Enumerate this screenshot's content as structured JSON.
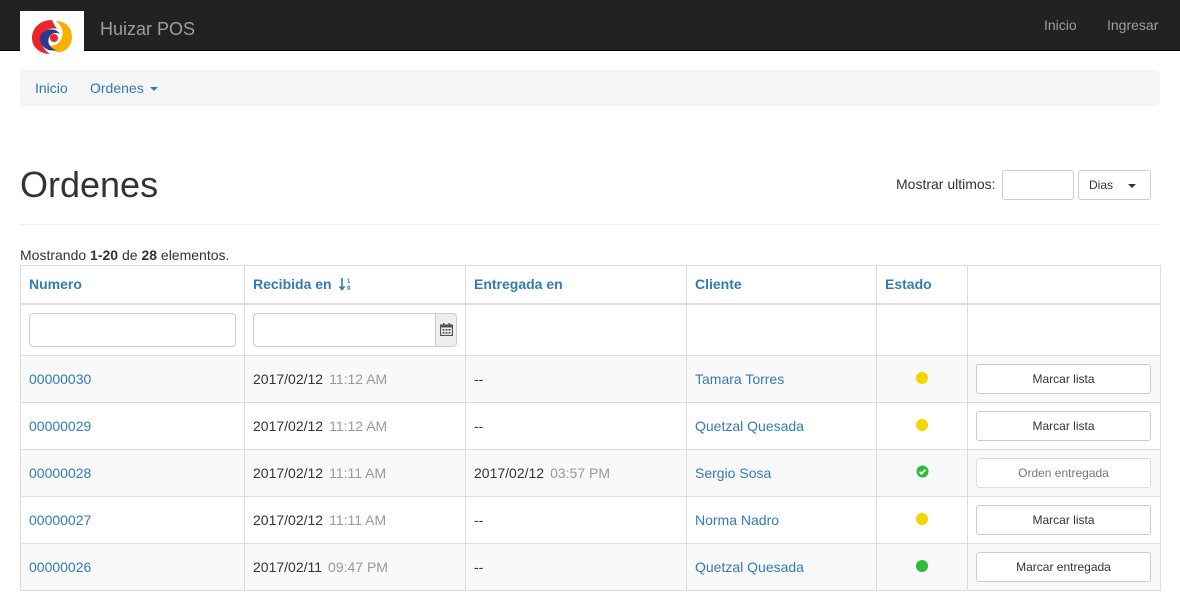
{
  "navbar": {
    "brand": "Huizar POS",
    "links": [
      "Inicio",
      "Ingresar"
    ]
  },
  "breadcrumb": {
    "items": [
      "Inicio",
      "Ordenes"
    ],
    "separator": "/"
  },
  "header": {
    "title": "Ordenes",
    "show_label": "Mostrar ultimos:",
    "days_input_value": "",
    "days_select": "Dias"
  },
  "summary": {
    "prefix": "Mostrando ",
    "range": "1-20",
    "middle": " de ",
    "total": "28",
    "suffix": " elementos."
  },
  "table": {
    "columns": [
      "Numero",
      "Recibida en",
      "Entregada en",
      "Cliente",
      "Estado",
      ""
    ],
    "rows": [
      {
        "numero": "00000030",
        "recibida_date": "2017/02/12",
        "recibida_time": "11:12 AM",
        "entregada_date": "--",
        "entregada_time": "",
        "cliente": "Tamara Torres",
        "estado": "yellow",
        "action": "Marcar lista"
      },
      {
        "numero": "00000029",
        "recibida_date": "2017/02/12",
        "recibida_time": "11:12 AM",
        "entregada_date": "--",
        "entregada_time": "",
        "cliente": "Quetzal Quesada",
        "estado": "yellow",
        "action": "Marcar lista"
      },
      {
        "numero": "00000028",
        "recibida_date": "2017/02/12",
        "recibida_time": "11:11 AM",
        "entregada_date": "2017/02/12",
        "entregada_time": "03:57 PM",
        "cliente": "Sergio Sosa",
        "estado": "green-check",
        "action": "Orden entregada"
      },
      {
        "numero": "00000027",
        "recibida_date": "2017/02/12",
        "recibida_time": "11:11 AM",
        "entregada_date": "--",
        "entregada_time": "",
        "cliente": "Norma Nadro",
        "estado": "yellow",
        "action": "Marcar lista"
      },
      {
        "numero": "00000026",
        "recibida_date": "2017/02/11",
        "recibida_time": "09:47 PM",
        "entregada_date": "--",
        "entregada_time": "",
        "cliente": "Quetzal Quesada",
        "estado": "green",
        "action": "Marcar entregada"
      }
    ]
  },
  "colors": {
    "navbar_bg": "#222222",
    "link": "#337ab7",
    "status_yellow": "#f5d400",
    "status_green": "#2dbb38"
  },
  "icons": {
    "sort": "sort-numeric-asc-icon",
    "calendar": "calendar-icon",
    "logo": "huizar-logo"
  }
}
